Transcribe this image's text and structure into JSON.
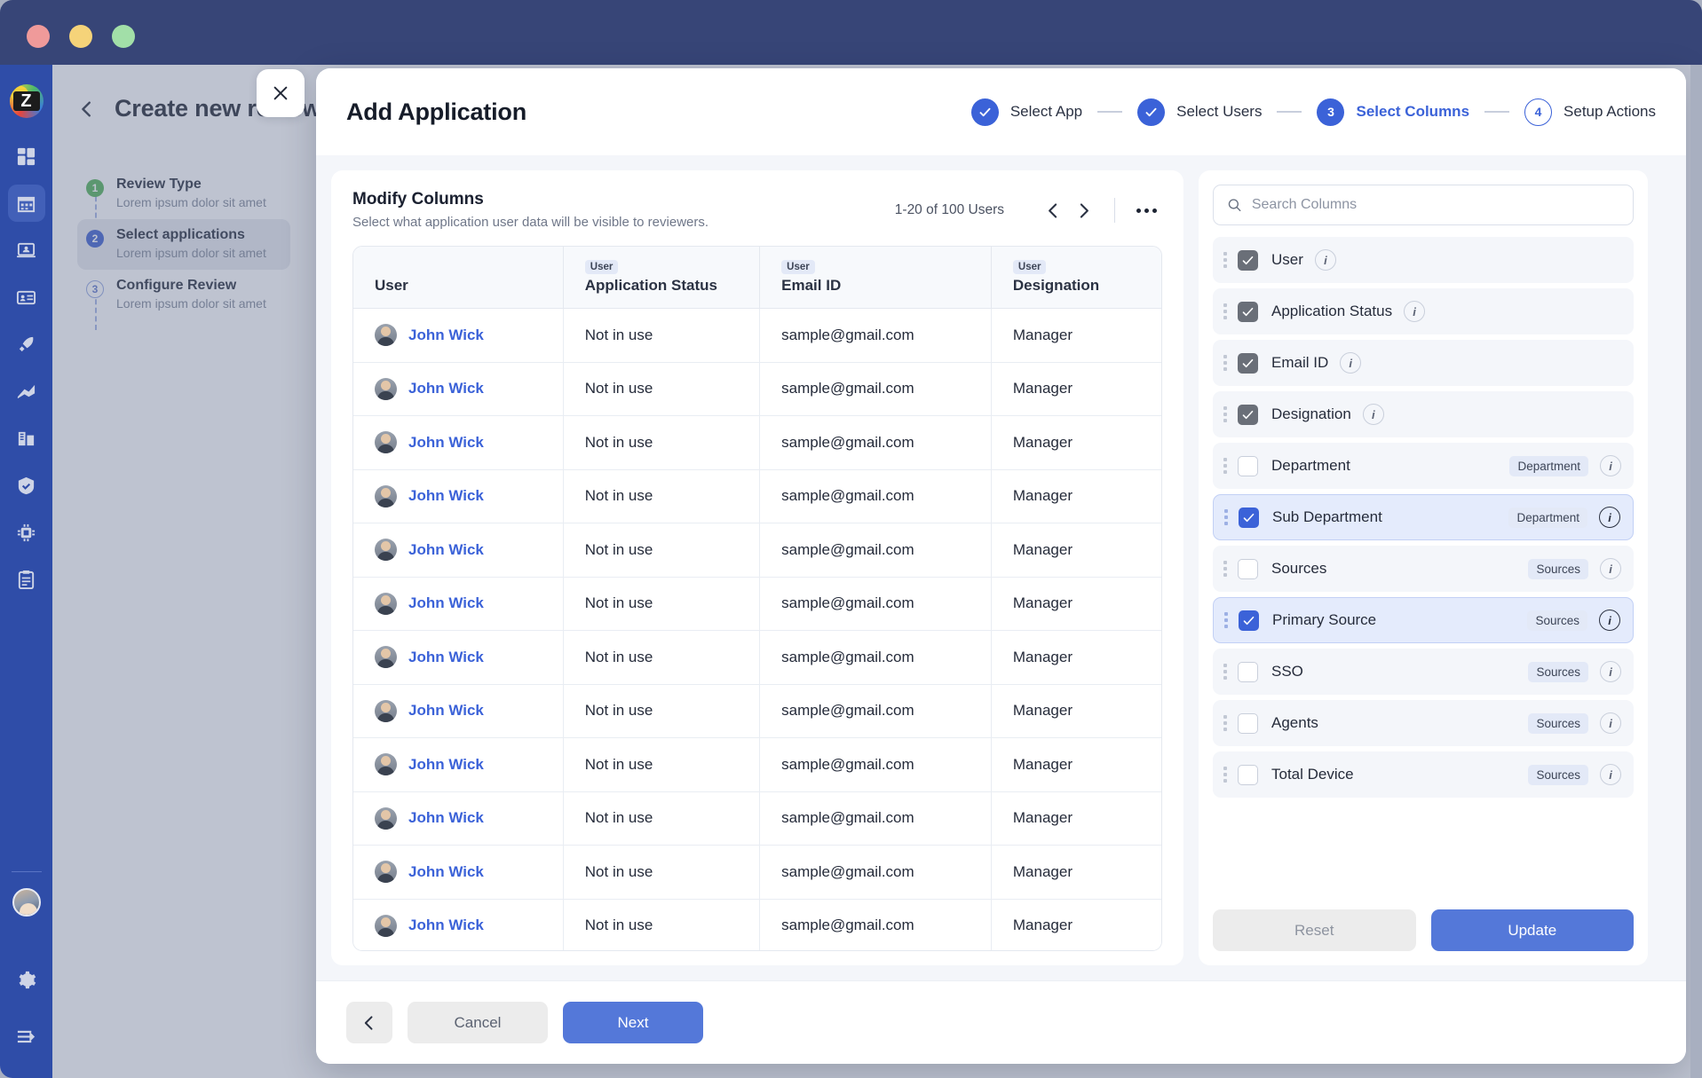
{
  "window": {
    "title_bar_color": "#374577",
    "lights": [
      "close",
      "minimize",
      "maximize"
    ]
  },
  "rail": {
    "logo_label": "Z",
    "items": [
      {
        "name": "dashboard-icon",
        "label": "Dashboard",
        "active": false
      },
      {
        "name": "calendar-icon",
        "label": "Calendar",
        "active": true
      },
      {
        "name": "device-icon",
        "label": "Devices",
        "active": false
      },
      {
        "name": "id-card-icon",
        "label": "Identity",
        "active": false
      },
      {
        "name": "rocket-icon",
        "label": "Launch",
        "active": false
      },
      {
        "name": "automation-icon",
        "label": "Automation",
        "active": false
      },
      {
        "name": "building-icon",
        "label": "Organization",
        "active": false
      },
      {
        "name": "shield-check-icon",
        "label": "Security",
        "active": false
      },
      {
        "name": "chip-icon",
        "label": "Integrations",
        "active": false
      },
      {
        "name": "clipboard-icon",
        "label": "Reviews",
        "active": false
      }
    ],
    "bottom": [
      {
        "name": "avatar",
        "label": "Profile"
      },
      {
        "name": "gear-icon",
        "label": "Settings"
      },
      {
        "name": "collapse-icon",
        "label": "Collapse sidebar"
      }
    ]
  },
  "background_page": {
    "back_label": "Back",
    "title": "Create new review",
    "steps": [
      {
        "num": "1",
        "title": "Review Type",
        "sub": "Lorem ipsum dolor sit amet",
        "state": "done"
      },
      {
        "num": "2",
        "title": "Select applications",
        "sub": "Lorem ipsum dolor sit amet",
        "state": "current"
      },
      {
        "num": "3",
        "title": "Configure Review",
        "sub": "Lorem ipsum dolor sit amet",
        "state": "todo"
      }
    ]
  },
  "modal": {
    "title": "Add Application",
    "close_label": "Close",
    "stepper": [
      {
        "num": "1",
        "label": "Select App",
        "state": "done"
      },
      {
        "num": "2",
        "label": "Select Users",
        "state": "done"
      },
      {
        "num": "3",
        "label": "Select Columns",
        "state": "current"
      },
      {
        "num": "4",
        "label": "Setup Actions",
        "state": "todo"
      }
    ]
  },
  "modify_columns": {
    "title": "Modify Columns",
    "subtitle": "Select what application user data will be visible to reviewers.",
    "pagination_text": "1-20 of 100 Users",
    "prev_label": "Previous page",
    "next_label": "Next page",
    "more_label": "More options"
  },
  "table": {
    "headers": [
      {
        "badge": "",
        "text": "User"
      },
      {
        "badge": "User",
        "text": "Application Status"
      },
      {
        "badge": "User",
        "text": "Email ID"
      },
      {
        "badge": "User",
        "text": "Designation"
      }
    ],
    "rows": [
      {
        "user": "John Wick",
        "status": "Not in use",
        "email": "sample@gmail.com",
        "designation": "Manager"
      },
      {
        "user": "John Wick",
        "status": "Not in use",
        "email": "sample@gmail.com",
        "designation": "Manager"
      },
      {
        "user": "John Wick",
        "status": "Not in use",
        "email": "sample@gmail.com",
        "designation": "Manager"
      },
      {
        "user": "John Wick",
        "status": "Not in use",
        "email": "sample@gmail.com",
        "designation": "Manager"
      },
      {
        "user": "John Wick",
        "status": "Not in use",
        "email": "sample@gmail.com",
        "designation": "Manager"
      },
      {
        "user": "John Wick",
        "status": "Not in use",
        "email": "sample@gmail.com",
        "designation": "Manager"
      },
      {
        "user": "John Wick",
        "status": "Not in use",
        "email": "sample@gmail.com",
        "designation": "Manager"
      },
      {
        "user": "John Wick",
        "status": "Not in use",
        "email": "sample@gmail.com",
        "designation": "Manager"
      },
      {
        "user": "John Wick",
        "status": "Not in use",
        "email": "sample@gmail.com",
        "designation": "Manager"
      },
      {
        "user": "John Wick",
        "status": "Not in use",
        "email": "sample@gmail.com",
        "designation": "Manager"
      },
      {
        "user": "John Wick",
        "status": "Not in use",
        "email": "sample@gmail.com",
        "designation": "Manager"
      },
      {
        "user": "John Wick",
        "status": "Not in use",
        "email": "sample@gmail.com",
        "designation": "Manager"
      }
    ]
  },
  "column_picker": {
    "search_placeholder": "Search Columns",
    "search_value": "",
    "info_label": "Info",
    "drag_label": "Drag to reorder",
    "rows": [
      {
        "label": "User",
        "tag": "",
        "checked": true,
        "style": "gray",
        "selected": false
      },
      {
        "label": "Application Status",
        "tag": "",
        "checked": true,
        "style": "gray",
        "selected": false
      },
      {
        "label": "Email ID",
        "tag": "",
        "checked": true,
        "style": "gray",
        "selected": false
      },
      {
        "label": "Designation",
        "tag": "",
        "checked": true,
        "style": "gray",
        "selected": false
      },
      {
        "label": "Department",
        "tag": "Department",
        "checked": false,
        "style": "off",
        "selected": false
      },
      {
        "label": "Sub Department",
        "tag": "Department",
        "checked": true,
        "style": "blue",
        "selected": true
      },
      {
        "label": "Sources",
        "tag": "Sources",
        "checked": false,
        "style": "off",
        "selected": false
      },
      {
        "label": "Primary Source",
        "tag": "Sources",
        "checked": true,
        "style": "blue",
        "selected": true
      },
      {
        "label": "SSO",
        "tag": "Sources",
        "checked": false,
        "style": "off",
        "selected": false
      },
      {
        "label": "Agents",
        "tag": "Sources",
        "checked": false,
        "style": "off",
        "selected": false
      },
      {
        "label": "Total Device",
        "tag": "Sources",
        "checked": false,
        "style": "off",
        "selected": false
      }
    ],
    "reset_label": "Reset",
    "update_label": "Update"
  },
  "footer": {
    "back_label": "Back",
    "cancel_label": "Cancel",
    "next_label": "Next"
  },
  "colors": {
    "accent": "#3b62d8",
    "button": "#5478d9",
    "titlebar": "#374577",
    "rail": "#2f4da8",
    "tag_bg": "#e3e9f7"
  }
}
